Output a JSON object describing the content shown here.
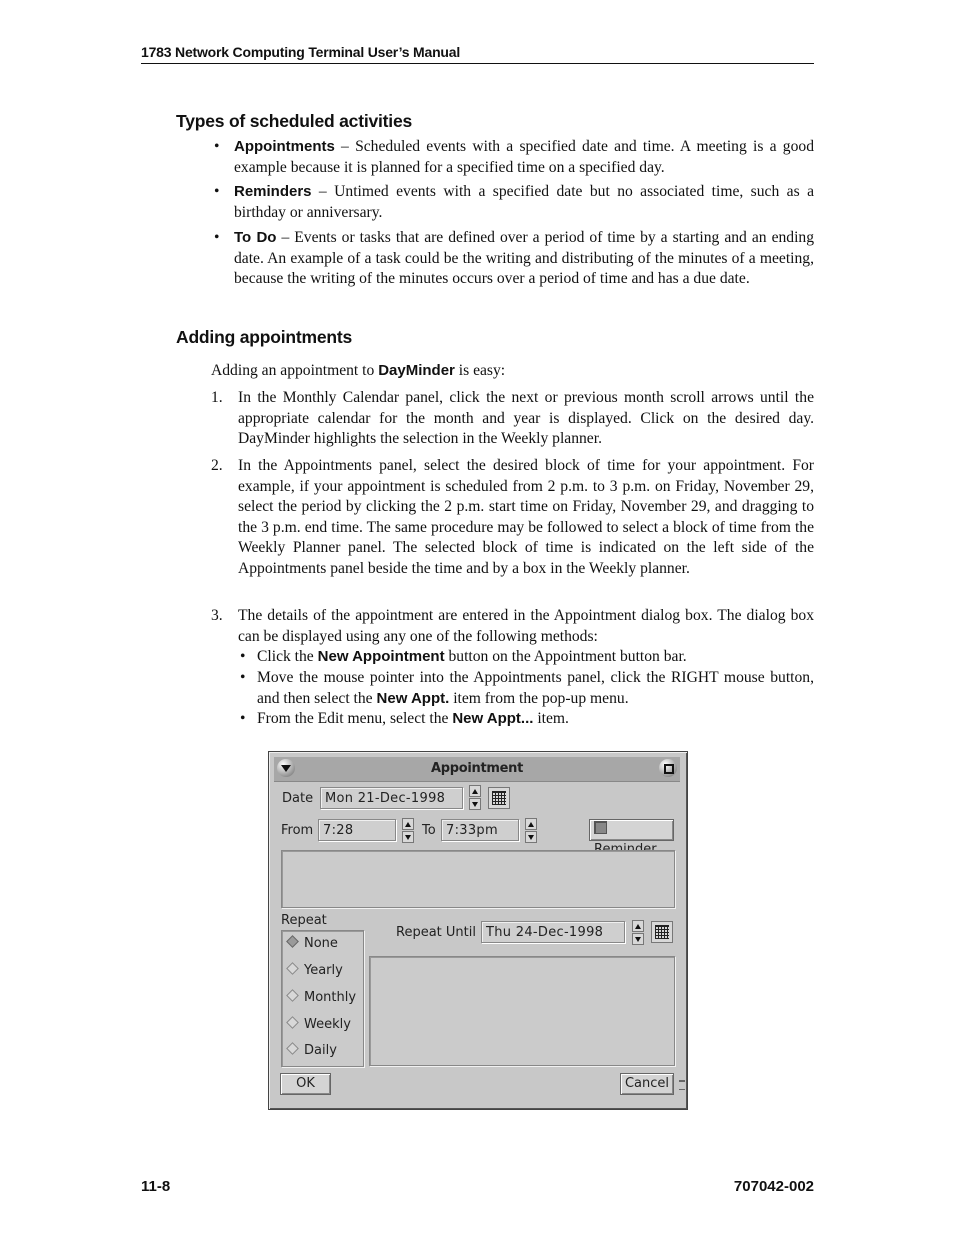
{
  "header": {
    "title": "1783 Network Computing Terminal User’s Manual"
  },
  "section1": {
    "heading": "Types of scheduled activities",
    "bullets": [
      {
        "term": "Appointments",
        "text_line1": " – Scheduled events with a specified date and time. A meeting is a",
        "text_rest": "good example because it is planned for a specified time on a specified day."
      },
      {
        "term": "Reminders",
        "text_line1": " – Untimed events with a specified date but no associated time, such as a",
        "text_rest": "birthday or anniversary."
      },
      {
        "term": "To Do",
        "text_line1": " – Events or tasks that are defined over a period of time by a starting and an",
        "text_rest": "ending date. An example of a task could be the writing and distributing of the minutes of a meeting, because the writing of the minutes occurs over a period of time and has a due date."
      }
    ]
  },
  "section2": {
    "heading": "Adding appointments",
    "intro_pre": "Adding an appointment to ",
    "intro_bold": "DayMinder",
    "intro_post": " is easy:",
    "steps": [
      {
        "num": "1.",
        "text": "In the Monthly Calendar panel, click the next or previous month scroll arrows until the appropriate calendar for the month and year is displayed. Click on the desired day. DayMinder highlights the selection in the Weekly planner."
      },
      {
        "num": "2.",
        "text": "In the Appointments panel, select the desired block of time for your appointment. For example, if your appointment is scheduled from 2 p.m. to 3 p.m. on Friday, November 29, select the period by clicking the 2 p.m. start time on Friday, November 29, and dragging to the 3 p.m. end time. The same procedure may be followed to select a block of time from the Weekly Planner panel. The selected block of time is indicated on the left side of the Appointments panel beside the time and by a box in the Weekly planner."
      },
      {
        "num": "3.",
        "text": "The details of the appointment are entered in the Appointment dialog box. The dialog box can be displayed using any one of the following methods:"
      }
    ],
    "methods": [
      {
        "pre": "Click the ",
        "bold": "New Appointment",
        "post": " button on the Appointment button bar."
      },
      {
        "pre": "Move the mouse pointer into the Appointments panel, click the RIGHT mouse button, and then select the ",
        "bold": "New Appt.",
        "post": " item from the pop-up menu."
      },
      {
        "pre": "From the Edit menu, select the ",
        "bold": "New Appt...",
        "post": " item."
      }
    ]
  },
  "dialog": {
    "title": "Appointment",
    "date_label": "Date",
    "date_value": "Mon  21-Dec-1998",
    "from_label": "From",
    "from_value": "7:28",
    "to_label": "To",
    "to_value": "7:33pm",
    "reminder_label": "Reminder",
    "reminder_checked": false,
    "notes_value": "",
    "repeat_label": "Repeat",
    "repeat_options": [
      "None",
      "Yearly",
      "Monthly",
      "Weekly",
      "Daily"
    ],
    "repeat_selected": "None",
    "repeat_until_label": "Repeat Until",
    "repeat_until_value": "Thu  24-Dec-1998",
    "ok_label": "OK",
    "cancel_label": "Cancel"
  },
  "footer": {
    "page": "11-8",
    "doc_number": "707042-002"
  }
}
